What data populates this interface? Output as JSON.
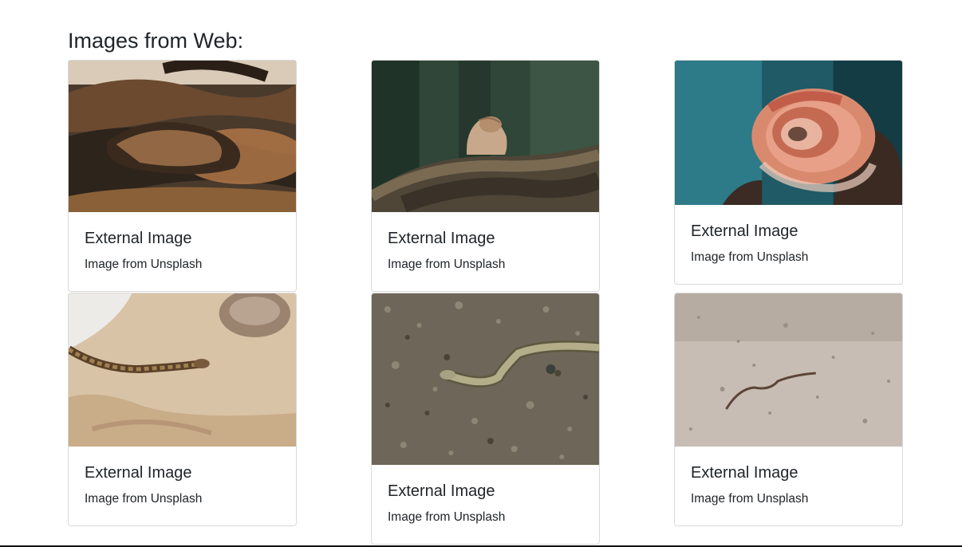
{
  "page": {
    "heading": "Images from Web:"
  },
  "cards": [
    {
      "title": "External Image",
      "text": "Image from Unsplash",
      "image": "coiled-brown-python-photo"
    },
    {
      "title": "External Image",
      "text": "Image from Unsplash",
      "image": "python-raising-head-photo"
    },
    {
      "title": "External Image",
      "text": "Image from Unsplash",
      "image": "coiled-red-boa-photo"
    },
    {
      "title": "External Image",
      "text": "Image from Unsplash",
      "image": "snake-on-sand-photo"
    },
    {
      "title": "External Image",
      "text": "Image from Unsplash",
      "image": "slow-worm-on-gravel-photo"
    },
    {
      "title": "External Image",
      "text": "Image from Unsplash",
      "image": "small-snake-on-dirt-photo"
    }
  ],
  "colors": {
    "text": "#212529",
    "card_border": "#d9d9d9",
    "background": "#ffffff"
  }
}
